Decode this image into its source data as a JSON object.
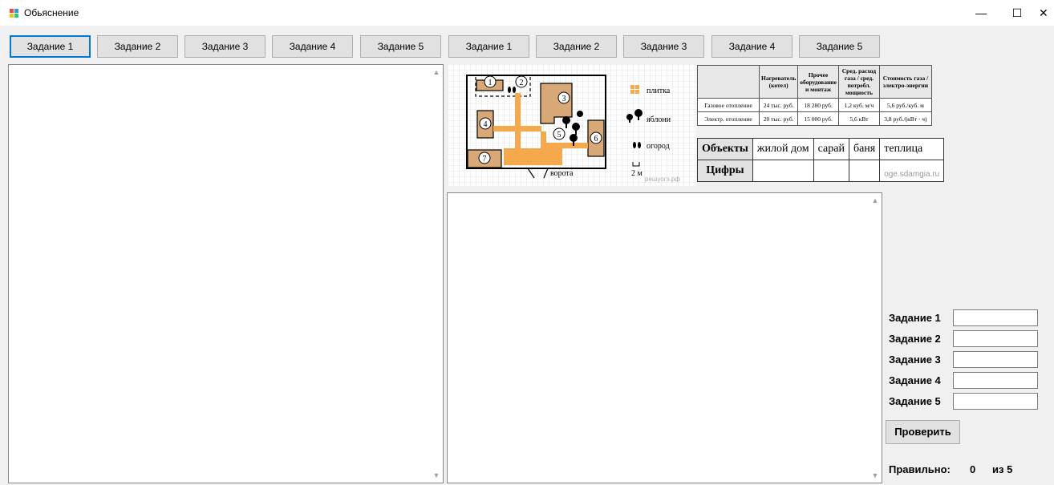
{
  "window": {
    "title": "Обьяснение",
    "minimize": "—",
    "maximize": "☐",
    "close": "✕"
  },
  "tabs_left": [
    "Задание 1",
    "Задание 2",
    "Задание 3",
    "Задание 4",
    "Задание 5"
  ],
  "tabs_right": [
    "Задание 1",
    "Задание 2",
    "Задание 3",
    "Задание 4",
    "Задание 5"
  ],
  "plan": {
    "numbers": [
      "1",
      "2",
      "3",
      "4",
      "5",
      "6",
      "7"
    ],
    "legend": {
      "tile": "плитка",
      "apples": "яблони",
      "garden": "огород",
      "scale": "2 м"
    },
    "gate": "ворота",
    "watermark": "решуогэ.рф"
  },
  "cost_table": {
    "headers": [
      "",
      "Нагреватель (котел)",
      "Прочее оборудование и монтаж",
      "Сред. расход газа / сред. потребл. мощность",
      "Стоимость газа / электро-энергии"
    ],
    "rows": [
      [
        "Газовое отопление",
        "24 тыс. руб.",
        "18 280 руб.",
        "1,2 куб. м/ч",
        "5,6 руб./куб. м"
      ],
      [
        "Электр. отопление",
        "20 тыс. руб.",
        "15 000 руб.",
        "5,6 кВт",
        "3,8 руб./(кВт · ч)"
      ]
    ]
  },
  "objects_table": {
    "header": "Объекты",
    "objects": [
      "жилой дом",
      "сарай",
      "баня",
      "теплица"
    ],
    "row_label": "Цифры",
    "watermark": "oge.sdamgia.ru"
  },
  "answers": [
    {
      "label": "Задание 1",
      "value": ""
    },
    {
      "label": "Задание 2",
      "value": ""
    },
    {
      "label": "Задание 3",
      "value": ""
    },
    {
      "label": "Задание 4",
      "value": ""
    },
    {
      "label": "Задание 5",
      "value": ""
    }
  ],
  "check_button": "Проверить",
  "result": {
    "label": "Правильно:",
    "score": "0",
    "of": "из 5"
  },
  "colors": {
    "accent": "#0078d7",
    "object_fill": "#d9a877",
    "tile": "#f5a94d"
  }
}
